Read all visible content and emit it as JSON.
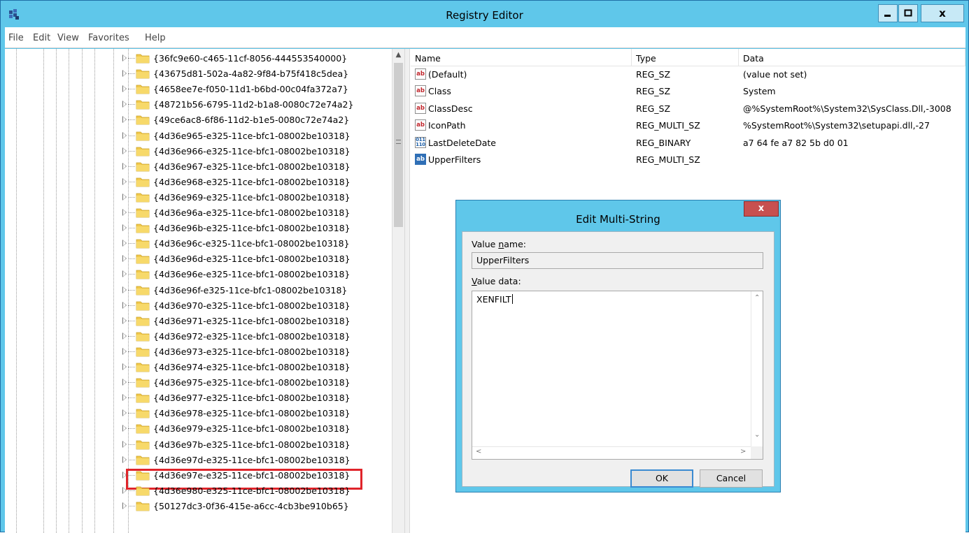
{
  "window": {
    "title": "Registry Editor"
  },
  "titlebar_buttons": {
    "minimize": "▁",
    "maximize": "□",
    "close": "x"
  },
  "menu": [
    "File",
    "Edit",
    "View",
    "Favorites",
    "Help"
  ],
  "tree": {
    "items": [
      "{36fc9e60-c465-11cf-8056-444553540000}",
      "{43675d81-502a-4a82-9f84-b75f418c5dea}",
      "{4658ee7e-f050-11d1-b6bd-00c04fa372a7}",
      "{48721b56-6795-11d2-b1a8-0080c72e74a2}",
      "{49ce6ac8-6f86-11d2-b1e5-0080c72e74a2}",
      "{4d36e965-e325-11ce-bfc1-08002be10318}",
      "{4d36e966-e325-11ce-bfc1-08002be10318}",
      "{4d36e967-e325-11ce-bfc1-08002be10318}",
      "{4d36e968-e325-11ce-bfc1-08002be10318}",
      "{4d36e969-e325-11ce-bfc1-08002be10318}",
      "{4d36e96a-e325-11ce-bfc1-08002be10318}",
      "{4d36e96b-e325-11ce-bfc1-08002be10318}",
      "{4d36e96c-e325-11ce-bfc1-08002be10318}",
      "{4d36e96d-e325-11ce-bfc1-08002be10318}",
      "{4d36e96e-e325-11ce-bfc1-08002be10318}",
      "{4d36e96f-e325-11ce-bfc1-08002be10318}",
      "{4d36e970-e325-11ce-bfc1-08002be10318}",
      "{4d36e971-e325-11ce-bfc1-08002be10318}",
      "{4d36e972-e325-11ce-bfc1-08002be10318}",
      "{4d36e973-e325-11ce-bfc1-08002be10318}",
      "{4d36e974-e325-11ce-bfc1-08002be10318}",
      "{4d36e975-e325-11ce-bfc1-08002be10318}",
      "{4d36e977-e325-11ce-bfc1-08002be10318}",
      "{4d36e978-e325-11ce-bfc1-08002be10318}",
      "{4d36e979-e325-11ce-bfc1-08002be10318}",
      "{4d36e97b-e325-11ce-bfc1-08002be10318}",
      "{4d36e97d-e325-11ce-bfc1-08002be10318}",
      "{4d36e97e-e325-11ce-bfc1-08002be10318}",
      "{4d36e980-e325-11ce-bfc1-08002be10318}",
      "{50127dc3-0f36-415e-a6cc-4cb3be910b65}"
    ],
    "highlighted": "{4d36e97d-e325-11ce-bfc1-08002be10318}"
  },
  "values": {
    "columns": [
      "Name",
      "Type",
      "Data"
    ],
    "rows": [
      {
        "icon": "ab",
        "name": "(Default)",
        "type": "REG_SZ",
        "data": "(value not set)"
      },
      {
        "icon": "ab",
        "name": "Class",
        "type": "REG_SZ",
        "data": "System"
      },
      {
        "icon": "ab",
        "name": "ClassDesc",
        "type": "REG_SZ",
        "data": "@%SystemRoot%\\System32\\SysClass.Dll,-3008"
      },
      {
        "icon": "ab",
        "name": "IconPath",
        "type": "REG_MULTI_SZ",
        "data": "%SystemRoot%\\System32\\setupapi.dll,-27"
      },
      {
        "icon": "011 110",
        "name": "LastDeleteDate",
        "type": "REG_BINARY",
        "data": "a7 64 fe a7 82 5b d0 01"
      },
      {
        "icon": "ab",
        "name": "UpperFilters",
        "type": "REG_MULTI_SZ",
        "data": ""
      }
    ]
  },
  "dialog": {
    "title": "Edit Multi-String",
    "close": "x",
    "value_name_label_pre": "Value ",
    "value_name_label_ul": "n",
    "value_name_label_post": "ame:",
    "value_name": "UpperFilters",
    "value_data_label_ul": "V",
    "value_data_label_post": "alue data:",
    "value_data": "XENFILT",
    "ok": "OK",
    "cancel": "Cancel"
  },
  "colors": {
    "titlebar": "#5fc7ea",
    "highlight_box": "#e0242a",
    "folder": "#f2c94c"
  }
}
